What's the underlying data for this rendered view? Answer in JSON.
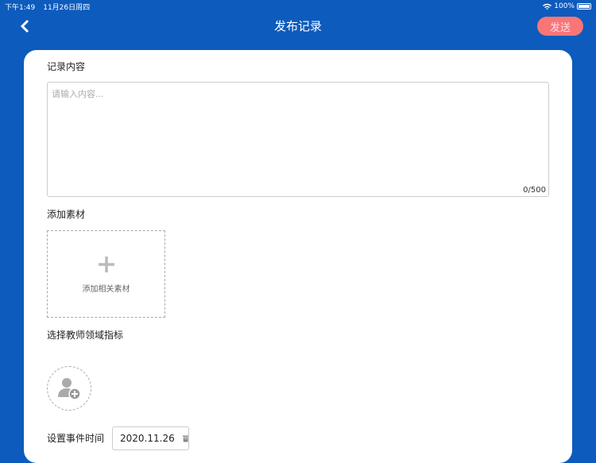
{
  "status": {
    "time": "下午1:49",
    "date": "11月26日周四",
    "battery": "100%"
  },
  "header": {
    "title": "发布记录",
    "send_label": "发送"
  },
  "content": {
    "label": "记录内容",
    "placeholder": "请输入内容...",
    "counter": "0/500"
  },
  "media": {
    "label": "添加素材",
    "add_label": "添加相关素材"
  },
  "indicator": {
    "label": "选择教师领域指标"
  },
  "event_time": {
    "label": "设置事件时间",
    "value": "2020.11.26"
  },
  "colors": {
    "header_bg": "#0d5bbd",
    "send_bg": "#f87676"
  }
}
